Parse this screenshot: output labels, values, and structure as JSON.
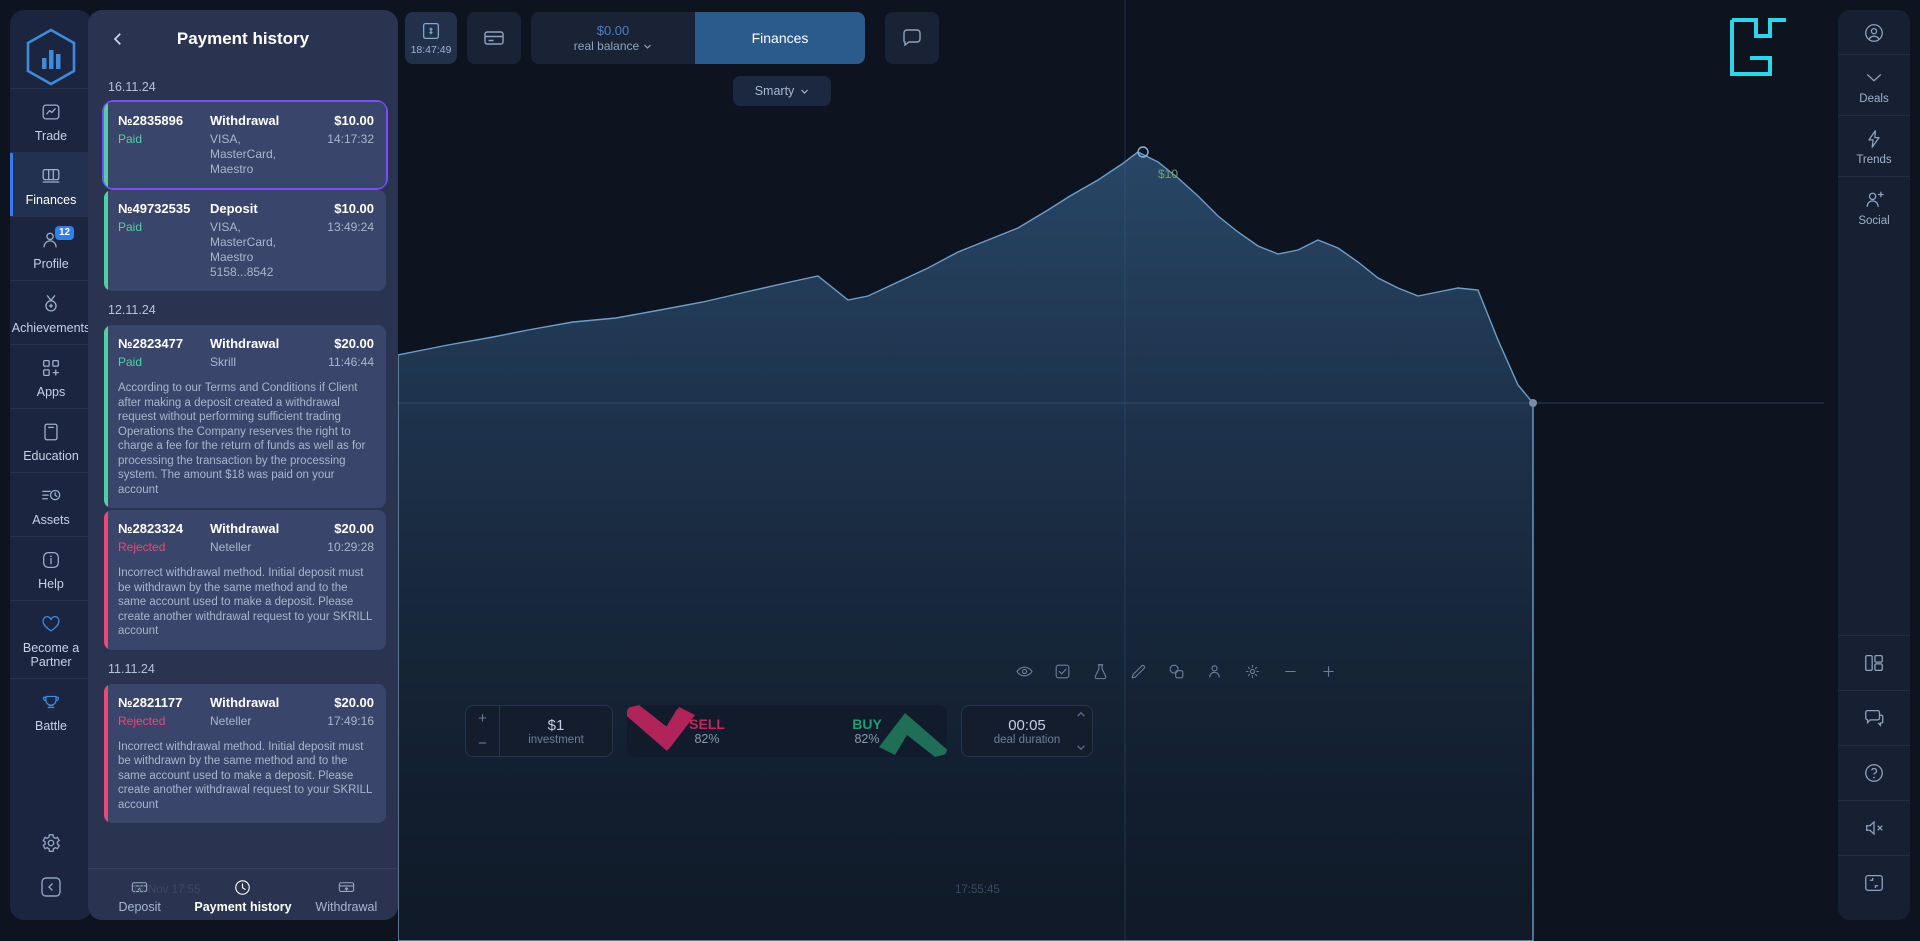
{
  "sidebar": {
    "logo_icon": "hexagon-bars-logo",
    "items": [
      {
        "label": "Trade",
        "icon": "chart-line-icon",
        "active": false
      },
      {
        "label": "Finances",
        "icon": "wallet-icon",
        "active": true
      },
      {
        "label": "Profile",
        "icon": "user-icon",
        "active": false,
        "badge": "12"
      },
      {
        "label": "Achievements",
        "icon": "medal-icon",
        "active": false
      },
      {
        "label": "Apps",
        "icon": "grid-plus-icon",
        "active": false
      },
      {
        "label": "Education",
        "icon": "book-icon",
        "active": false
      },
      {
        "label": "Assets",
        "icon": "list-clock-icon",
        "active": false
      },
      {
        "label": "Help",
        "icon": "info-circle-icon",
        "active": false
      },
      {
        "label": "Become a Partner",
        "icon": "heart-icon",
        "active": false,
        "accent": true
      },
      {
        "label": "Battle",
        "icon": "trophy-icon",
        "active": false,
        "accent": true
      }
    ],
    "bottom_icons": [
      "gear-icon",
      "collapse-left-icon"
    ]
  },
  "panel": {
    "title": "Payment history",
    "back_icon": "chevron-left-icon",
    "groups": [
      {
        "date": "16.11.24",
        "entries": [
          {
            "id": "№2835896",
            "status": "Paid",
            "status_kind": "paid",
            "type": "Withdrawal",
            "method": "VISA, MasterCard, Maestro",
            "amount": "$10.00",
            "time": "14:17:32",
            "selected": true,
            "note": ""
          },
          {
            "id": "№49732535",
            "status": "Paid",
            "status_kind": "paid",
            "type": "Deposit",
            "method": "VISA, MasterCard, Maestro 5158...8542",
            "amount": "$10.00",
            "time": "13:49:24",
            "selected": false,
            "note": ""
          }
        ]
      },
      {
        "date": "12.11.24",
        "entries": [
          {
            "id": "№2823477",
            "status": "Paid",
            "status_kind": "paid",
            "type": "Withdrawal",
            "method": "Skrill",
            "amount": "$20.00",
            "time": "11:46:44",
            "selected": false,
            "note": "According to our Terms and Conditions if Client after making a deposit created a withdrawal request without performing sufficient trading Operations the Company reserves the right to charge a fee for the return of funds as well as for processing the transaction by the processing system.\nThe amount $18 was paid on your account"
          },
          {
            "id": "№2823324",
            "status": "Rejected",
            "status_kind": "rejected",
            "type": "Withdrawal",
            "method": "Neteller",
            "amount": "$20.00",
            "time": "10:29:28",
            "selected": false,
            "note": "Incorrect withdrawal method. Initial deposit must be withdrawn by the same method and to the same account used to make a deposit. Please create another withdrawal request to your SKRILL account"
          }
        ]
      },
      {
        "date": "11.11.24",
        "entries": [
          {
            "id": "№2821177",
            "status": "Rejected",
            "status_kind": "rejected",
            "type": "Withdrawal",
            "method": "Neteller",
            "amount": "$20.00",
            "time": "17:49:16",
            "selected": false,
            "note": "Incorrect withdrawal method. Initial deposit must be withdrawn by the same method and to the same account used to make a deposit. Please create another withdrawal request to your SKRILL account"
          }
        ]
      }
    ],
    "tabs": [
      {
        "label": "Deposit",
        "icon": "card-deposit-icon",
        "active": false
      },
      {
        "label": "Payment history",
        "icon": "clock-icon",
        "active": true
      },
      {
        "label": "Withdrawal",
        "icon": "card-withdraw-icon",
        "active": false
      }
    ]
  },
  "topbar": {
    "clock_icon": "timer-dollar-icon",
    "clock_time": "18:47:49",
    "card_icon": "card-stack-icon",
    "balance_amount": "$0.00",
    "balance_label": "real balance",
    "balance_chevron": "chevron-down-icon",
    "finances_label": "Finances",
    "chat_icon": "support-chat-icon",
    "smarty_label": "Smarty",
    "smarty_chevron": "chevron-down-icon",
    "brand_icon": "t-brand-logo"
  },
  "chart": {
    "tools": [
      "eye-icon",
      "checkbox-icon",
      "flask-icon",
      "pencil-icon",
      "shapes-icon",
      "person-icon",
      "settings-icon",
      "minus-icon",
      "plus-icon"
    ],
    "marker_label": "$10"
  },
  "trade": {
    "investment_value": "$1",
    "investment_label": "investment",
    "plus": "+",
    "minus": "−",
    "sell_label": "SELL",
    "sell_percent": "82%",
    "buy_label": "BUY",
    "buy_percent": "82%",
    "duration_value": "00:05",
    "duration_label": "deal duration",
    "timestamp_left": "18 Nov 17:55",
    "timestamp_right": "17:55:45"
  },
  "rightbar": {
    "items": [
      {
        "label": "",
        "icon": "account-circle-icon"
      },
      {
        "label": "Deals",
        "icon": "deals-chevron-icon"
      },
      {
        "label": "Trends",
        "icon": "trends-bolt-icon"
      },
      {
        "label": "Social",
        "icon": "social-user-plus-icon"
      }
    ],
    "bottom_icons": [
      "layout-icon",
      "chat-icon",
      "help-icon",
      "mute-icon",
      "fullscreen-icon"
    ]
  },
  "colors": {
    "accent_blue": "#2f80ed",
    "selected_purple": "#7c4dff",
    "paid_green": "#4fd1a5",
    "rejected_pink": "#e8487a",
    "sell_red": "#c0285c",
    "buy_green": "#1f9e72"
  }
}
